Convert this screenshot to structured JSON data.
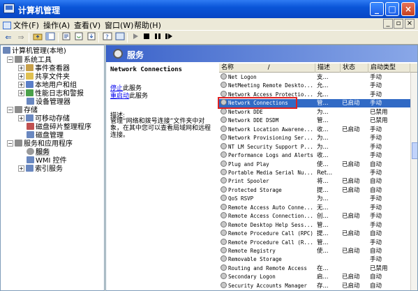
{
  "window": {
    "title": "计算机管理",
    "min": "_",
    "max": "□",
    "close": "×"
  },
  "menu": [
    {
      "label": "文件(F)"
    },
    {
      "label": "操作(A)"
    },
    {
      "label": "查看(V)"
    },
    {
      "label": "窗口(W)"
    },
    {
      "label": "帮助(H)"
    }
  ],
  "mdi": {
    "min": "_",
    "restore": "▫",
    "close": "×"
  },
  "toolbar": {
    "back": "⇐",
    "forward": "⇒"
  },
  "tree": [
    {
      "label": "计算机管理(本地)",
      "icon_color": "#6b86b8"
    },
    {
      "label": "系统工具",
      "icon_color": "#8c8c8c"
    },
    {
      "label": "事件查看器",
      "icon_color": "#c8a04a"
    },
    {
      "label": "共享文件夹",
      "icon_color": "#e0c050"
    },
    {
      "label": "本地用户和组",
      "icon_color": "#5a7ec8"
    },
    {
      "label": "性能日志和警报",
      "icon_color": "#4aa04a"
    },
    {
      "label": "设备管理器",
      "icon_color": "#6a88c0"
    },
    {
      "label": "存储",
      "icon_color": "#8c8c8c"
    },
    {
      "label": "可移动存储",
      "icon_color": "#6a88c0"
    },
    {
      "label": "磁盘碎片整理程序",
      "icon_color": "#c05050"
    },
    {
      "label": "磁盘管理",
      "icon_color": "#6a88c0"
    },
    {
      "label": "服务和应用程序",
      "icon_color": "#8c8c8c"
    },
    {
      "label": "服务",
      "icon_color": "#9a9a9a"
    },
    {
      "label": "WMI 控件",
      "icon_color": "#6a88c0"
    },
    {
      "label": "索引服务",
      "icon_color": "#6a88c0"
    }
  ],
  "pane": {
    "title": "服务"
  },
  "description": {
    "service_name": "Network Connections",
    "stop_link": "停止",
    "stop_suffix": "此服务",
    "restart_link": "重启动",
    "restart_suffix": "此服务",
    "label": "描述:",
    "text": "管理“网络和拨号连接”文件夹中对象，在其中您可以查看局域网和远程连接。"
  },
  "columns": {
    "name": "名称",
    "sort": "/",
    "desc": "描述",
    "status": "状态",
    "startup": "启动类型"
  },
  "services": [
    {
      "name": "Net Logon",
      "desc": "支...",
      "status": "",
      "startup": "手动"
    },
    {
      "name": "NetMeeting Remote Deskto...",
      "desc": "允...",
      "status": "",
      "startup": "手动"
    },
    {
      "name": "Network Access Protectio...",
      "desc": "允...",
      "status": "",
      "startup": "手动"
    },
    {
      "name": "Network Connections",
      "desc": "管...",
      "status": "已启动",
      "startup": "手动"
    },
    {
      "name": "Network DDE",
      "desc": "为...",
      "status": "",
      "startup": "已禁用"
    },
    {
      "name": "Network DDE DSDM",
      "desc": "管...",
      "status": "",
      "startup": "已禁用"
    },
    {
      "name": "Network Location Awarene...",
      "desc": "收...",
      "status": "已启动",
      "startup": "手动"
    },
    {
      "name": "Network Provisioning Ser...",
      "desc": "为...",
      "status": "",
      "startup": "手动"
    },
    {
      "name": "NT LM Security Support P...",
      "desc": "为...",
      "status": "",
      "startup": "手动"
    },
    {
      "name": "Performance Logs and Alerts",
      "desc": "收...",
      "status": "",
      "startup": "手动"
    },
    {
      "name": "Plug and Play",
      "desc": "使...",
      "status": "已启动",
      "startup": "自动"
    },
    {
      "name": "Portable Media Serial Nu...",
      "desc": "Ret...",
      "status": "",
      "startup": "手动"
    },
    {
      "name": "Print Spooler",
      "desc": "将...",
      "status": "已启动",
      "startup": "自动"
    },
    {
      "name": "Protected Storage",
      "desc": "提...",
      "status": "已启动",
      "startup": "自动"
    },
    {
      "name": "QoS RSVP",
      "desc": "为...",
      "status": "",
      "startup": "手动"
    },
    {
      "name": "Remote Access Auto Conne...",
      "desc": "无...",
      "status": "",
      "startup": "手动"
    },
    {
      "name": "Remote Access Connection...",
      "desc": "创...",
      "status": "已启动",
      "startup": "手动"
    },
    {
      "name": "Remote Desktop Help Sess...",
      "desc": "管...",
      "status": "",
      "startup": "手动"
    },
    {
      "name": "Remote Procedure Call (RPC)",
      "desc": "提...",
      "status": "已启动",
      "startup": "自动"
    },
    {
      "name": "Remote Procedure Call (R...",
      "desc": "管...",
      "status": "",
      "startup": "手动"
    },
    {
      "name": "Remote Registry",
      "desc": "使...",
      "status": "已启动",
      "startup": "自动"
    },
    {
      "name": "Removable Storage",
      "desc": "",
      "status": "",
      "startup": "手动"
    },
    {
      "name": "Routing and Remote Access",
      "desc": "在...",
      "status": "",
      "startup": "已禁用"
    },
    {
      "name": "Secondary Logon",
      "desc": "启...",
      "status": "已启动",
      "startup": "自动"
    },
    {
      "name": "Security Accounts Manager",
      "desc": "存...",
      "status": "已启动",
      "startup": "自动"
    }
  ],
  "selected_service": "Network Connections",
  "accent_color": "#316ac5",
  "highlight_color": "#e02020"
}
